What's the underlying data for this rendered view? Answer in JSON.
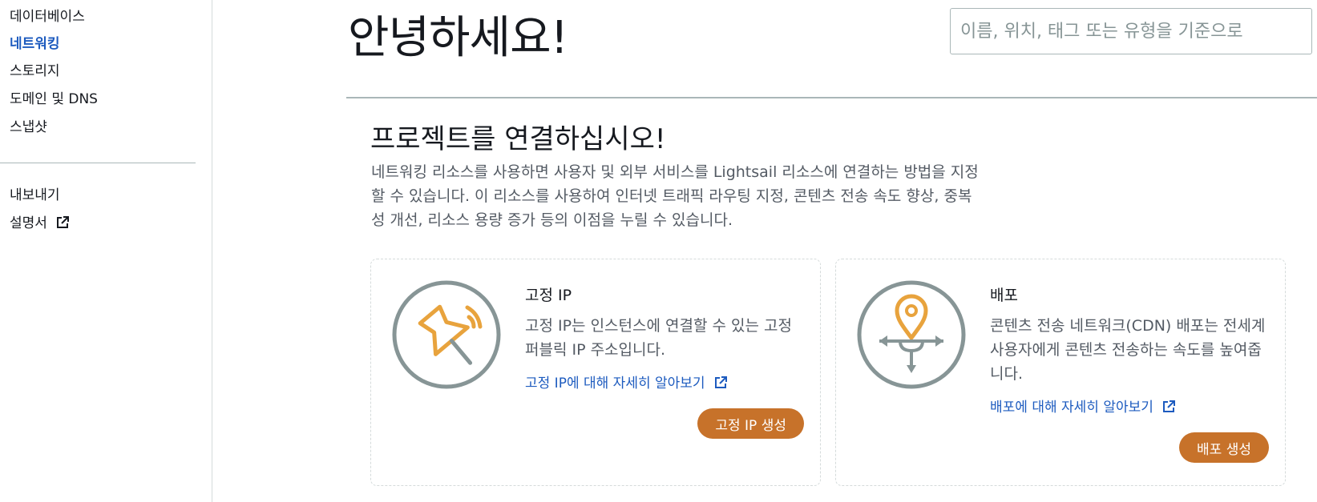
{
  "sidebar": {
    "items": [
      {
        "label": "데이터베이스"
      },
      {
        "label": "네트워킹",
        "active": true
      },
      {
        "label": "스토리지"
      },
      {
        "label": "도메인 및 DNS"
      },
      {
        "label": "스냅샷"
      }
    ],
    "bottom_items": [
      {
        "label": "내보내기"
      },
      {
        "label": "설명서",
        "icon": "external-link-icon"
      }
    ]
  },
  "header": {
    "greeting": "안녕하세요!",
    "search_placeholder": "이름, 위치, 태그 또는 유형을 기준으로"
  },
  "section": {
    "title": "프로젝트를 연결하십시오!",
    "description": "네트워킹 리소스를 사용하면 사용자 및 외부 서비스를 Lightsail 리소스에 연결하는 방법을 지정할 수 있습니다. 이 리소스를 사용하여 인터넷 트래픽 라우팅 지정, 콘텐츠 전송 속도 향상, 중복성 개선, 리소스 용량 증가 등의 이점을 누릴 수 있습니다."
  },
  "cards": [
    {
      "title": "고정 IP",
      "description": "고정 IP는 인스턴스에 연결할 수 있는 고정 퍼블릭 IP 주소입니다.",
      "link": "고정 IP에 대해 자세히 알아보기",
      "button": "고정 IP 생성",
      "icon": "pushpin-icon"
    },
    {
      "title": "배포",
      "description": "콘텐츠 전송 네트워크(CDN) 배포는 전세계 사용자에게 콘텐츠 전송하는 속도를 높여줍니다.",
      "link": "배포에 대해 자세히 알아보기",
      "button": "배포 생성",
      "icon": "distribution-icon"
    }
  ],
  "colors": {
    "accent_link": "#1d5bbf",
    "button": "#c7722a",
    "icon_orange": "#e8a33d",
    "icon_gray": "#879596"
  }
}
